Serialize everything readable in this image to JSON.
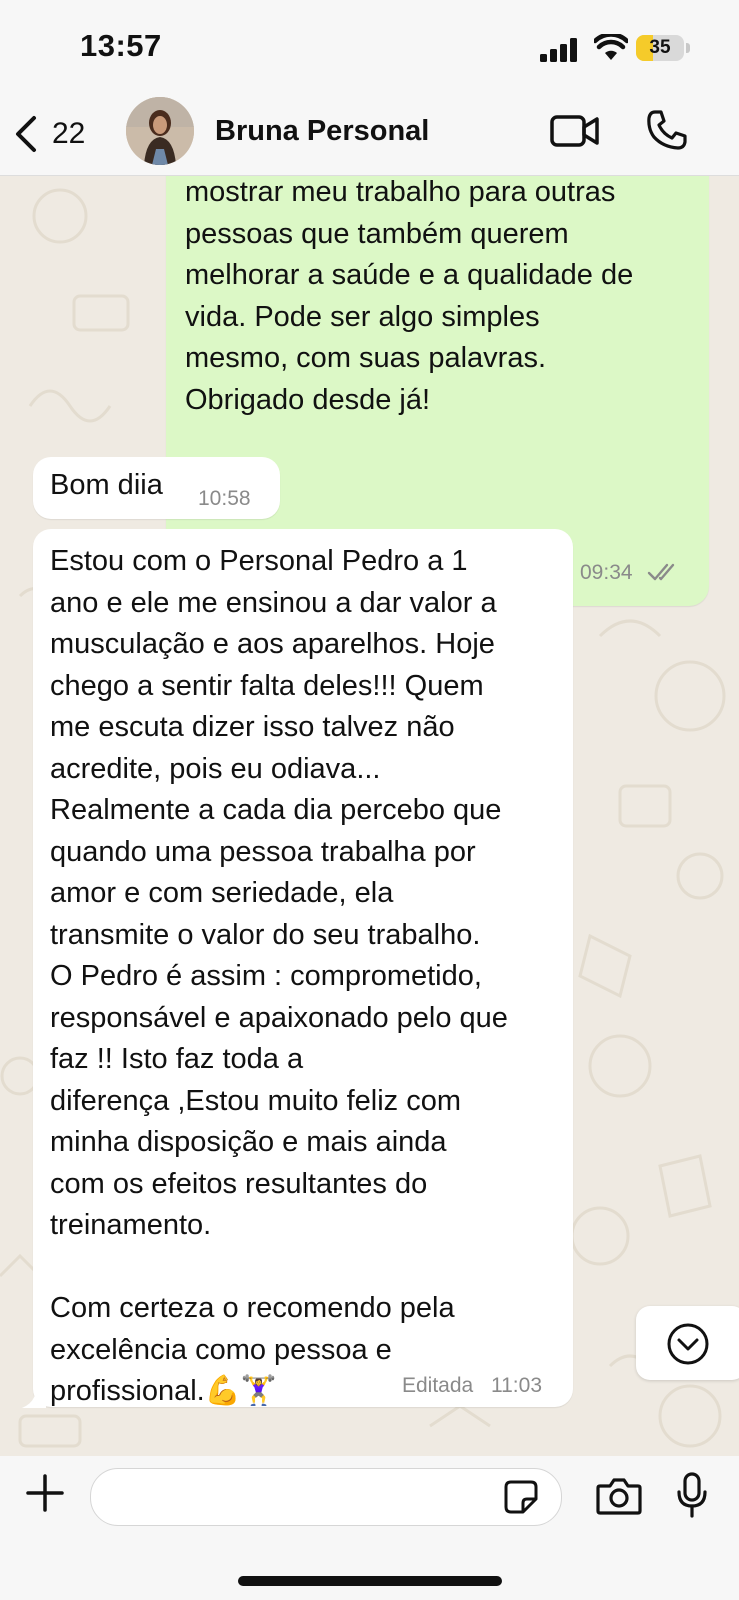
{
  "status_bar": {
    "time": "13:57",
    "battery": "35",
    "battery_level_percent": 35
  },
  "header": {
    "back_count": "22",
    "contact_name": "Bruna Personal",
    "icons": [
      "chevron-left-icon",
      "video-call-icon",
      "phone-icon"
    ]
  },
  "messages": [
    {
      "direction": "outgoing",
      "text": "mostrar meu trabalho para outras\npessoas que também querem\nmelhorar a saúde e a qualidade de\nvida. Pode ser algo simples\nmesmo, com suas palavras.\nObrigado desde já!",
      "time": "09:34",
      "status": "read"
    },
    {
      "direction": "incoming",
      "text": "Bom diia",
      "time": "10:58"
    },
    {
      "direction": "incoming",
      "text": "Estou com o Personal Pedro a 1\nano e ele me ensinou a dar valor a\nmusculação e aos aparelhos. Hoje\nchego a sentir falta deles!!! Quem\nme escuta dizer isso talvez não\nacredite, pois eu odiava...\nRealmente a cada dia percebo que\nquando uma pessoa trabalha por\namor e com seriedade, ela\ntransmite o valor do seu trabalho.\nO Pedro é assim : comprometido,\nresponsável e apaixonado pelo que\nfaz !! Isto faz toda a\ndiferença ,Estou muito feliz com\nminha disposição e mais ainda\ncom os efeitos resultantes do\ntreinamento.\n\nCom certeza o recomendo pela\nexcelência como pessoa e\nprofissional.💪🏋️‍♀️",
      "edited_label": "Editada",
      "time": "11:03"
    }
  ],
  "composer": {
    "icons": [
      "plus-icon",
      "sticker-icon",
      "camera-icon",
      "microphone-icon"
    ]
  },
  "colors": {
    "chat_background": "#efeae2",
    "outgoing_bubble": "#dcf8c6",
    "incoming_bubble": "#ffffff",
    "read_ticks": "#8a8a8a",
    "bar_background": "#f7f7f7"
  }
}
